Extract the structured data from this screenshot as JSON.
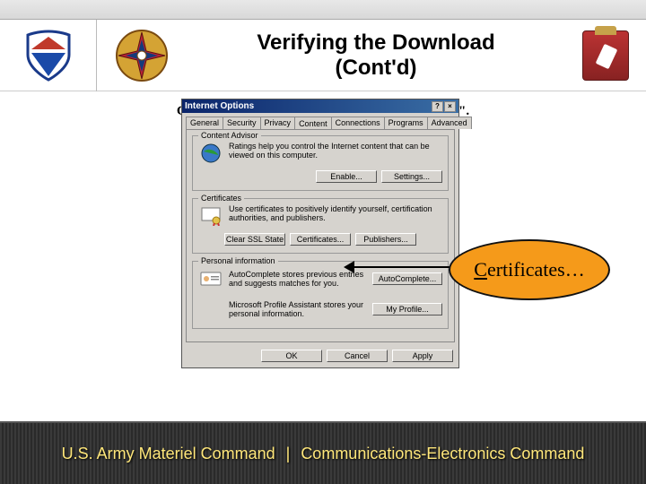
{
  "title_line1": "Verifying the Download",
  "title_line2": "(Cont'd)",
  "dialog": {
    "title": "Internet Options",
    "tabs": [
      "General",
      "Security",
      "Privacy",
      "Content",
      "Connections",
      "Programs",
      "Advanced"
    ],
    "active_tab": "Content",
    "content_advisor": {
      "label": "Content Advisor",
      "text": "Ratings help you control the Internet content that can be viewed on this computer.",
      "enable": "Enable...",
      "settings": "Settings..."
    },
    "certificates": {
      "label": "Certificates",
      "text": "Use certificates to positively identify yourself, certification authorities, and publishers.",
      "clear_ssl": "Clear SSL State",
      "certificates": "Certificates...",
      "publishers": "Publishers..."
    },
    "personal": {
      "label": "Personal information",
      "autocomplete_text": "AutoComplete stores previous entries and suggests matches for you.",
      "autocomplete_btn": "AutoComplete...",
      "profile_text": "Microsoft Profile Assistant stores your personal information.",
      "profile_btn": "My Profile..."
    },
    "buttons": {
      "ok": "OK",
      "cancel": "Cancel",
      "apply": "Apply"
    }
  },
  "callout": {
    "prefix": "C",
    "rest": "ertificates…"
  },
  "caption_parts": {
    "p1": "Click the \"Content\" tab. Now, click \"",
    "u": "C",
    "p2": "ertificates\"."
  },
  "footer": {
    "left": "U.S. Army Materiel Command",
    "sep": "|",
    "right": "Communications-Electronics Command"
  }
}
